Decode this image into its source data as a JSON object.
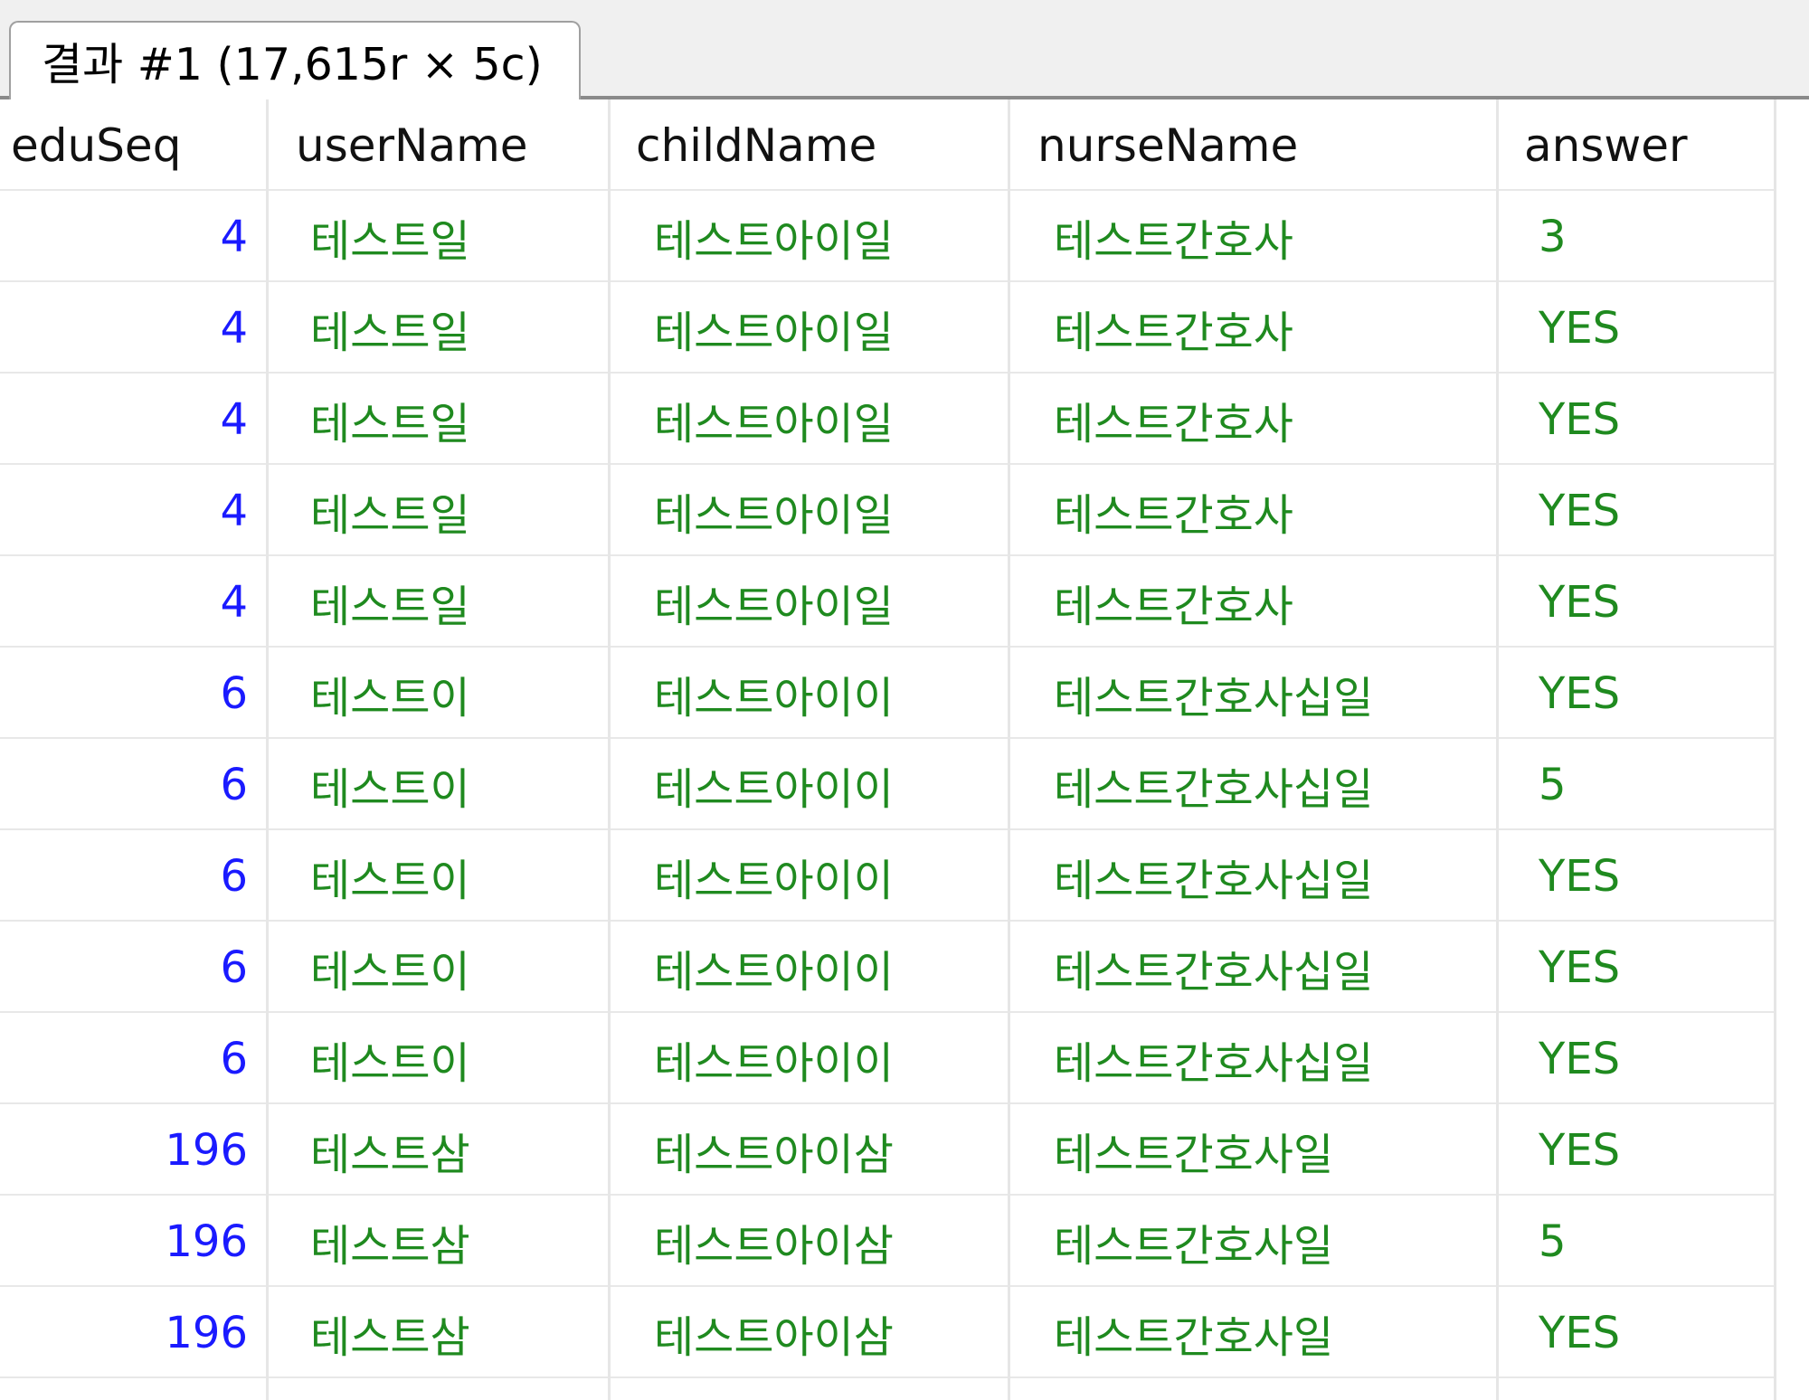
{
  "tab": {
    "label": "결과 #1 (17,615r × 5c)"
  },
  "columns": [
    "eduSeq",
    "userName",
    "childName",
    "nurseName",
    "answer"
  ],
  "rows": [
    [
      "4",
      "테스트일",
      "테스트아이일",
      "테스트간호사",
      "3"
    ],
    [
      "4",
      "테스트일",
      "테스트아이일",
      "테스트간호사",
      "YES"
    ],
    [
      "4",
      "테스트일",
      "테스트아이일",
      "테스트간호사",
      "YES"
    ],
    [
      "4",
      "테스트일",
      "테스트아이일",
      "테스트간호사",
      "YES"
    ],
    [
      "4",
      "테스트일",
      "테스트아이일",
      "테스트간호사",
      "YES"
    ],
    [
      "6",
      "테스트이",
      "테스트아이이",
      "테스트간호사십일",
      "YES"
    ],
    [
      "6",
      "테스트이",
      "테스트아이이",
      "테스트간호사십일",
      "5"
    ],
    [
      "6",
      "테스트이",
      "테스트아이이",
      "테스트간호사십일",
      "YES"
    ],
    [
      "6",
      "테스트이",
      "테스트아이이",
      "테스트간호사십일",
      "YES"
    ],
    [
      "6",
      "테스트이",
      "테스트아이이",
      "테스트간호사십일",
      "YES"
    ],
    [
      "196",
      "테스트삼",
      "테스트아이삼",
      "테스트간호사일",
      "YES"
    ],
    [
      "196",
      "테스트삼",
      "테스트아이삼",
      "테스트간호사일",
      "5"
    ],
    [
      "196",
      "테스트삼",
      "테스트아이삼",
      "테스트간호사일",
      "YES"
    ],
    [
      "",
      "",
      "",
      "",
      ""
    ]
  ],
  "colors": {
    "numeric": "#1a1aff",
    "text": "#1f8a1f",
    "header": "#111111"
  }
}
